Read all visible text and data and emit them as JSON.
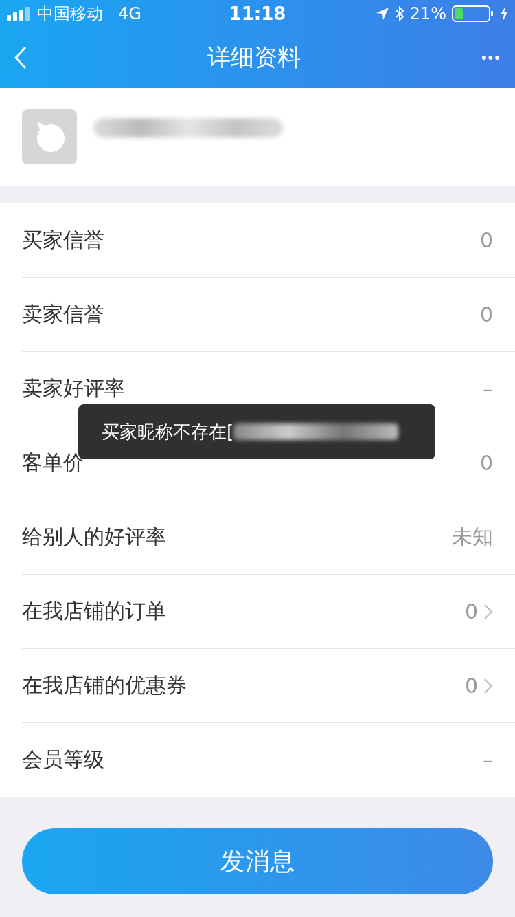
{
  "status_bar": {
    "carrier": "中国移动",
    "network": "4G",
    "time": "11:18",
    "battery": "21%"
  },
  "nav": {
    "title": "详细资料",
    "more": "•••"
  },
  "rows": [
    {
      "label": "买家信誉",
      "value": "0",
      "kind": "plain"
    },
    {
      "label": "卖家信誉",
      "value": "0",
      "kind": "plain"
    },
    {
      "label": "卖家好评率",
      "value": "–",
      "kind": "plain"
    },
    {
      "label": "客单价",
      "value": "0",
      "kind": "plain"
    },
    {
      "label": "给别人的好评率",
      "value": "未知",
      "kind": "plain"
    },
    {
      "label": "在我店铺的订单",
      "value": "0",
      "kind": "link"
    },
    {
      "label": "在我店铺的优惠券",
      "value": "0",
      "kind": "link"
    },
    {
      "label": "会员等级",
      "value": "–",
      "kind": "plain"
    }
  ],
  "toast": {
    "text": "买家昵称不存在["
  },
  "send_button": "发消息"
}
